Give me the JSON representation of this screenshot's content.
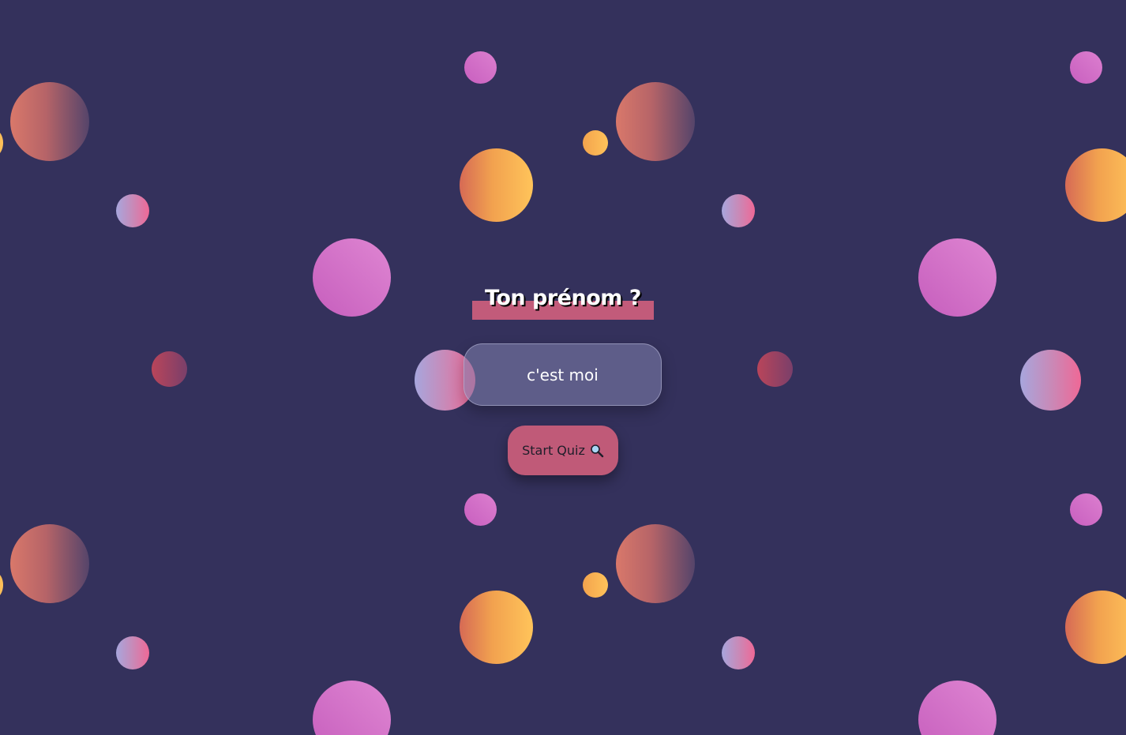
{
  "form": {
    "title": "Ton prénom ?",
    "name_input_value": "c'est moi",
    "start_button_label": "Start Quiz",
    "start_button_icon": "magnifier-icon"
  },
  "colors": {
    "background": "#34315c",
    "accent": "#c05a78",
    "title_text": "#ffffff"
  }
}
